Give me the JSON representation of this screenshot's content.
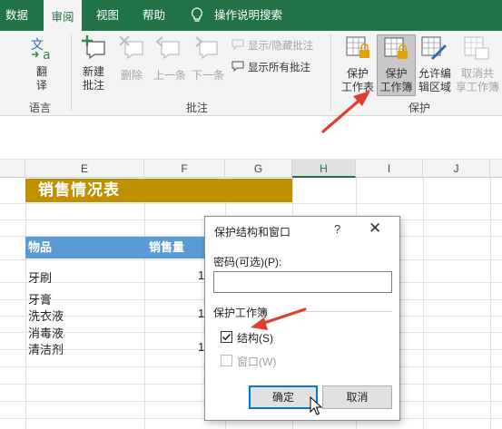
{
  "tabs": [
    {
      "label": "数据",
      "active": false
    },
    {
      "label": "审阅",
      "active": true
    },
    {
      "label": "视图",
      "active": false
    },
    {
      "label": "帮助",
      "active": false
    }
  ],
  "tell_me": {
    "icon": "lightbulb-icon",
    "label": "操作说明搜索"
  },
  "ribbon": {
    "language": {
      "translate_label": "翻\n译",
      "group_label": "语言"
    },
    "comments": {
      "new_comment": "新建\n批注",
      "delete": "删除",
      "previous": "上一条",
      "next": "下一条",
      "show_hide": "显示/隐藏批注",
      "show_all": "显示所有批注",
      "group_label": "批注"
    },
    "protect": {
      "protect_sheet": "保护\n工作表",
      "protect_workbook": "保护\n工作簿",
      "allow_edit_ranges": "允许编\n辑区域",
      "unshare_workbook": "取消共\n享工作簿",
      "group_label": "保护"
    }
  },
  "columns": [
    "E",
    "F",
    "G",
    "H",
    "I",
    "J"
  ],
  "selected_column": "H",
  "sheet": {
    "title": "销售情况表",
    "headers": {
      "item": "物品",
      "qty": "销售量"
    },
    "items": [
      "牙刷",
      "牙膏",
      "洗衣液",
      "消毒液",
      "清洁剂"
    ],
    "qty_partial": [
      "1",
      "",
      "1",
      "",
      "1"
    ]
  },
  "dialog": {
    "title": "保护结构和窗口",
    "help": "?",
    "close": "✕",
    "password_label": "密码(可选)(P):",
    "password_value": "",
    "section_label": "保护工作簿",
    "structure_label": "结构(S)",
    "structure_checked": true,
    "window_label": "窗口(W)",
    "window_checked": false,
    "ok_label": "确定",
    "cancel_label": "取消"
  },
  "colors": {
    "excel_green": "#217346",
    "title_fill": "#bf9000",
    "header_fill": "#5b9bd5",
    "arrow_red": "#e03c31"
  }
}
